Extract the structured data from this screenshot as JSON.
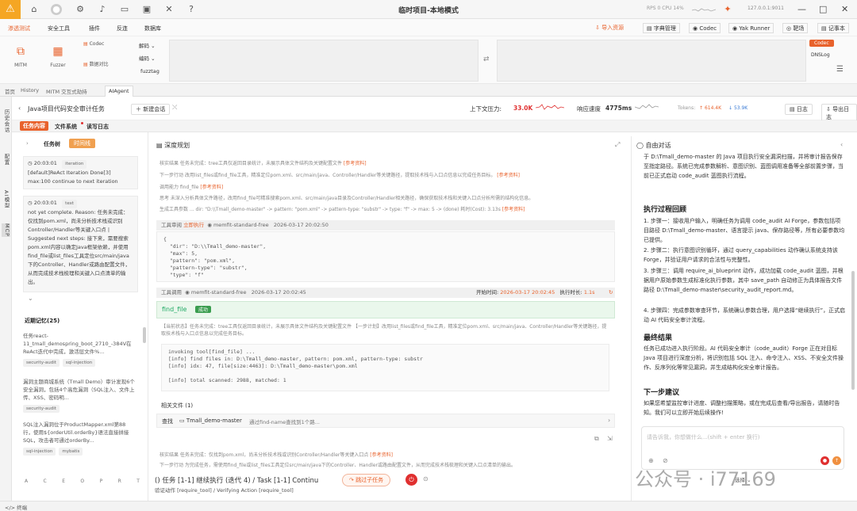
{
  "window": {
    "title": "临时项目-本地模式",
    "stats": "RPS 0  CPU 14%",
    "ip": "127.0.0.1:9011"
  },
  "menubar": {
    "items": [
      "渗透测试",
      "安全工具",
      "插件",
      "反连",
      "数据库"
    ],
    "right": [
      "导入资源",
      "字典管理",
      "Codec",
      "Yak Runner",
      "靶场",
      "记事本"
    ]
  },
  "ribbon": {
    "tools": [
      "MITM",
      "Fuzzer",
      "Codec",
      "数据对比"
    ],
    "codec_menu": [
      "解码",
      "编码",
      "fuzztag"
    ],
    "right_badges": [
      "Codec",
      "DNSLog"
    ]
  },
  "tabs": [
    "首页",
    "History",
    "MITM 交互式劫持",
    "AIAgent"
  ],
  "rail": [
    "历史会话",
    "配置",
    "AI模型",
    "MCP"
  ],
  "task": {
    "title": "Java项目代码安全审计任务",
    "new_session": "新建会话",
    "pressure_label": "上下文压力:",
    "pressure_value": "33.0K",
    "speed_label": "响应速度",
    "speed_value": "4775ms",
    "tokens_label": "Tokens:",
    "tokens_up": "614.4K",
    "tokens_down": "53.9K",
    "log_btn": "日志",
    "export_btn": "导出日志"
  },
  "subtabs": [
    "任务内容",
    "文件系统",
    "读写日志"
  ],
  "left": {
    "switch": [
      "任务树",
      "时间线"
    ],
    "log1_time": "20:03:01",
    "log1_type": "iteration",
    "log1_text": "[default]ReAct Iteration Done[3] max:100 continue to next iteration",
    "log2_time": "20:03:01",
    "log2_type": "text",
    "log2_text": "not yet complete. Reason: 任务未完成：仅找到pom.xml，尚未分析技术栈或识别Controller/Handler等关键入口点 | Suggested next steps: 接下来，需要搜索pom.xml内容以确定Java框架依赖，并使用find_file或list_files工具定位src/main/java下的Controller、Handler或路由配置文件，从而完成技术栈梳理和关键入口点清单的输出。",
    "mem_title": "近期记忆(25)",
    "mem1": "任务react-11_tmall_demospring_boot_2710_-384V在ReAct迭代中完成，激活层文件%...",
    "mem1_tags": [
      "security-audit",
      "sql-injection"
    ],
    "mem2": "漏洞主题商城系统（Tmall Demo）审计发现6个安全漏洞，包括4个高危漏洞（SQL注入、文件上传、XSS、密码明...",
    "mem2_tags": [
      "security-audit"
    ],
    "mem3": "SQL注入漏洞位于ProductMapper.xml第88行，使用${orderUtil.orderBy}语法直接拼接SQL，攻击者可通过orderBy...",
    "mem3_tags": [
      "sql-injection",
      "mybatis"
    ],
    "letters": [
      "A",
      "C",
      "E",
      "O",
      "P",
      "R",
      "T"
    ]
  },
  "mid": {
    "title": "深度规划",
    "line1": "核实结果  任务未完成：tree工具仅返回目录统计，未展示具体文件结构及关键配置文件",
    "ref": "[参考资料]",
    "line2": "下一步行动  改用list_files或find_file工具，精准定位pom.xml、src/main/java、Controller/Handler等关键路径，提取技术栈与入口点信息以完成任务目标。",
    "line3": "调用能力  find_file",
    "line4": "思考  未深入分析具体文件路径，改用find_file可精准搜索pom.xml、src/main/java目录及Controller/Handler相关路径，确保获取技术栈和关键入口点分析所需的结构化信息。",
    "line5": "生成工具参数  ... dir: \"D:\\\\Tmall_demo-master\" -> pattern: \"pom.xml\" -> pattern-type: \"substr\" -> type: \"f\" -> max: 5 -> (done) 耗时(Cost): 3.13s",
    "review_label": "工具审阅",
    "review_state": "立即执行",
    "model": "memfit-standard-free",
    "review_time": "2026-03-17 20:02:50",
    "review_code": "{\n  \"dir\": \"D:\\\\Tmall_demo-master\",\n  \"max\": 5,\n  \"pattern\": \"pom.xml\",\n  \"pattern-type\": \"substr\",\n  \"type\": \"f\"",
    "call_label": "工具调用",
    "call_time": "2026-03-17 20:02:45",
    "start_label": "开始时间:",
    "start_value": "2026-03-17 20:02:45",
    "exec_label": "执行时长:",
    "exec_value": "1.1s",
    "tool_name": "find_file",
    "tool_status": "成功",
    "status_text": "【当前状态】任务未完成：tree工具仅返回目录统计，未展示具体文件结构及关键配置文件 【一步计划】改用list_files或find_file工具，精准定位pom.xml、src/main/java、Controller/Handler等关键路径，提取技术栈与入口点信息以完成任务目标。",
    "output": "invoking tool[find_file] ...\n[info] find files in: D:\\Tmall_demo-master, pattern: pom.xml, pattern-type: substr\n[info] idx: 47, file[size:4463]: D:\\Tmall_demo-master\\pom.xml\n\n[info] total scanned: 2988, matched: 1",
    "files_label": "相关文件 (1)",
    "file_action": "查找",
    "file_name": "Tmall_demo-master",
    "file_desc": "通过find-name查找到1个路...",
    "bottom1": "核实结果  任务未完成：仅找到pom.xml，尚未分析技术栈或识别Controller/Handler等关键入口点",
    "bottom2": "下一步行动  为完成任务，需使用find_file或list_files工具定位src/main/java下的Controller、Handler或路由配置文件，从而完成技术栈梳理和关键入口点清单的输出。",
    "task_line": "() 任务 [1-1] 继续执行 (迭代 4) / Task [1-1] Continu",
    "skip_btn": "跳过子任务",
    "verify": "验证动作 [require_tool] / Verifying Action [require_tool]"
  },
  "right": {
    "title": "自由对话",
    "intro": "于 D:\\Tmall_demo-master 的 Java 项目执行安全漏洞扫描，并将审计报告保存至指定路径。系统已完成参数解析、意图识别、蓝图调用准备等全部前置步骤，当前已正式启动 code_audit 蓝图执行流程。",
    "h1": "执行过程回顾",
    "steps": [
      "1. 步骤一：接收用户输入，明确任务为调用 code_audit AI Forge，参数包括项目路径 D:\\Tmall_demo-master、语言提示 java、保存路径等，所有必要参数均已提供。",
      "2. 步骤二：执行意图识别循环，通过 query_capabilities 动作确认系统支持该 Forge，并验证用户请求的合法性与完整性。",
      "3. 步骤三：调用 require_ai_blueprint 动作，成功加载 code_audit 蓝图，并根据用户原始参数生成标准化执行参数，其中 save_path 自动修正为具体报告文件路径 D:\\Tmall_demo-master\\security_audit_report.md。",
      "4. 步骤四：完成参数审查环节，系统确认参数合理，用户选择“继续执行”，正式启动 AI 代码安全审计流程。"
    ],
    "h2": "最终结果",
    "result": "任务已成功进入执行阶段。AI 代码安全审计（code_audit）Forge 正在对目标 Java 项目进行深度分析，将识别包括 SQL 注入、命令注入、XSS、不安全文件操作、反序列化等常见漏洞，并生成结构化安全审计报告。",
    "h3": "下一步建议",
    "advice": "如果您希望监控审计进度、调整扫描策略，或在完成后查看/导出报告，请随时告知。我们可以立即开始后续操作!",
    "input_placeholder": "请告诉我，你想做什么...(shift + enter 换行)",
    "select_label": "选择"
  },
  "status": {
    "label": "终端"
  },
  "watermark": "公众号 · i77169"
}
